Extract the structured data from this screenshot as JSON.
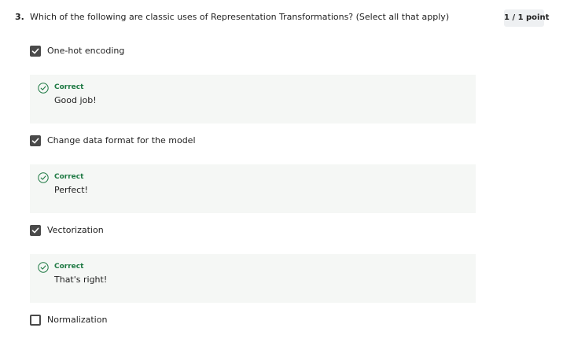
{
  "question": {
    "number": "3.",
    "text": "Which of the following are classic uses of Representation Transformations? (Select all that apply)",
    "score": "1 / 1 point"
  },
  "options": [
    {
      "label": "One-hot encoding",
      "checked": true,
      "feedback": {
        "status": "Correct",
        "message": "Good job!",
        "icon": "check-circle-icon"
      }
    },
    {
      "label": "Change data format for the model",
      "checked": true,
      "feedback": {
        "status": "Correct",
        "message": "Perfect!",
        "icon": "check-circle-icon"
      }
    },
    {
      "label": "Vectorization",
      "checked": true,
      "feedback": {
        "status": "Correct",
        "message": "That's right!",
        "icon": "check-circle-icon"
      }
    },
    {
      "label": "Normalization",
      "checked": false
    }
  ],
  "colors": {
    "correct": "#1f7a44",
    "checkbox": "#4a4a4a",
    "feedback_bg": "#f5f7f5",
    "badge_bg": "#eef0f2"
  }
}
